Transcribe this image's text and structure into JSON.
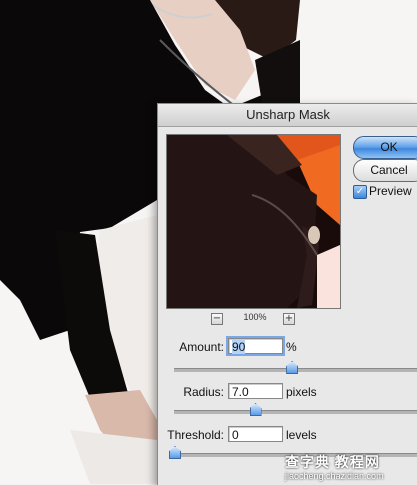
{
  "dialog": {
    "title": "Unsharp Mask",
    "ok_label": "OK",
    "cancel_label": "Cancel",
    "preview_label": "Preview",
    "preview_checked": true,
    "zoom": "100%",
    "zoom_out_symbol": "−",
    "zoom_in_symbol": "+"
  },
  "controls": {
    "amount": {
      "label": "Amount:",
      "value": "90",
      "unit": "%",
      "slider_fraction": 0.48
    },
    "radius": {
      "label": "Radius:",
      "value": "7.0",
      "unit": "pixels",
      "slider_fraction": 0.33
    },
    "threshold": {
      "label": "Threshold:",
      "value": "0",
      "unit": "levels",
      "slider_fraction": 0.0
    }
  },
  "watermark": {
    "logo": "查字典 教程网",
    "url": "jiaocheng.chazidian.com"
  },
  "colors": {
    "accent": "#3d86dd",
    "dialog_bg": "#e8e8e8"
  }
}
